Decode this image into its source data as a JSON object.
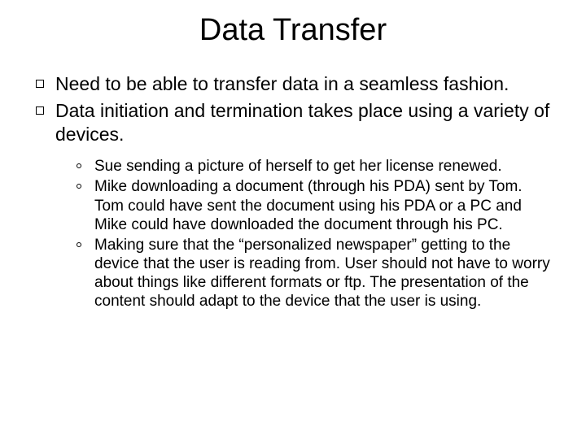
{
  "title": "Data Transfer",
  "bullets": [
    "Need to be able to transfer data in a seamless fashion.",
    "Data initiation and termination takes place using a variety of devices."
  ],
  "subbullets": [
    "Sue sending a picture of herself to get her license renewed.",
    "Mike downloading a document  (through his PDA) sent by Tom.  Tom  could have sent the document  using his PDA or a PC and Mike could have downloaded the document through his PC.",
    "Making sure that the “personalized newspaper” getting to the device that the user is reading from.  User should not have to worry about things like different formats or ftp.  The presentation of the content should adapt to the device that the user is using."
  ]
}
